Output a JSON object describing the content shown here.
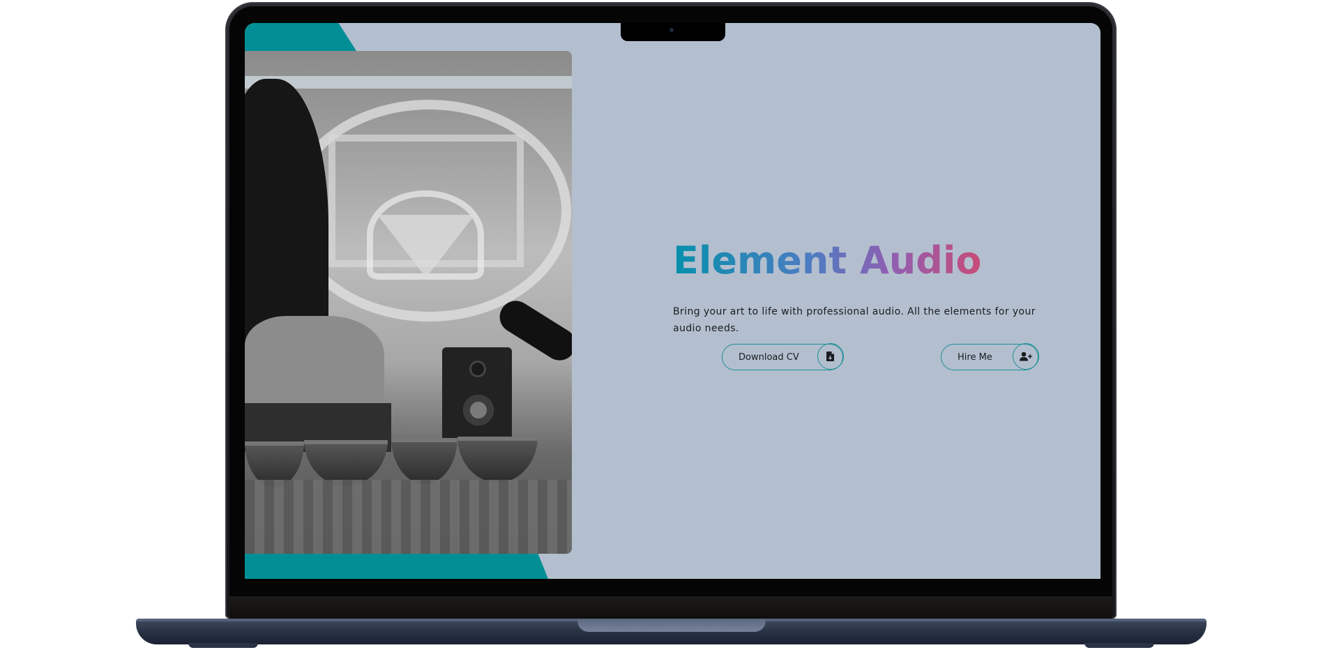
{
  "hero": {
    "title": "Element Audio",
    "tagline": "Bring your art to life with professional audio. All the elements for your audio needs."
  },
  "actions": {
    "download_cv_label": "Download CV",
    "download_cv_icon": "file-download-icon",
    "hire_me_label": "Hire Me",
    "hire_me_icon": "user-plus-icon"
  },
  "colors": {
    "accent_teal": "#018f95",
    "background": "#b3bfcf",
    "title_gradient": [
      "#0590ab",
      "#4e7cc2",
      "#8e5fb3",
      "#c84c78"
    ],
    "button_border": "#1d8f96"
  }
}
